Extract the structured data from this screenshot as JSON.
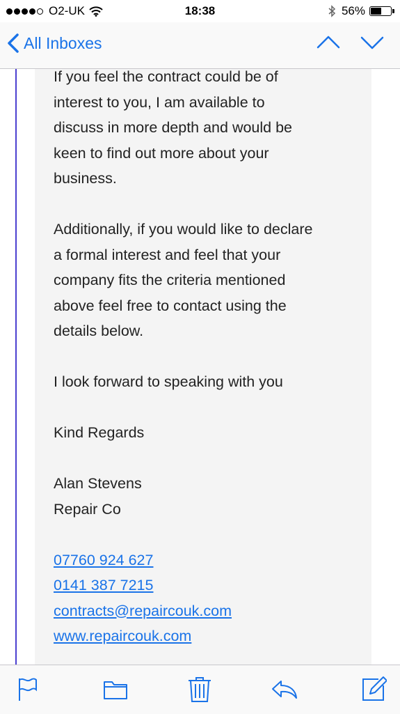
{
  "status_bar": {
    "carrier": "O2-UK",
    "time": "18:38",
    "battery_percent": "56%",
    "battery_level": 0.56,
    "signal_bars": 4,
    "signal_max": 5
  },
  "nav": {
    "back_label": "All Inboxes",
    "up_icon": "chevron-up-icon",
    "down_icon": "chevron-down-icon",
    "accent_color": "#1a73e8"
  },
  "message": {
    "paragraph1": [
      "If you feel the contract could be of",
      "interest to you, I am available to",
      "discuss in more depth and would be",
      "keen to find out more about your",
      "business."
    ],
    "paragraph2": [
      "Additionally, if you would like to declare",
      "a formal interest and feel that your",
      "company fits the criteria mentioned",
      "above feel free to contact using the",
      "details below."
    ],
    "closing_line": "I look forward to speaking with you",
    "sign_off": "Kind Regards",
    "sender_name": "Alan Stevens",
    "sender_company": "Repair Co",
    "phone_mobile": "07760 924 627",
    "phone_landline": "0141 387 7215",
    "email": "contracts@repaircouk.com",
    "website": "www.repaircouk.com"
  },
  "toolbar": {
    "icons": [
      "flag-icon",
      "folder-icon",
      "trash-icon",
      "reply-icon",
      "compose-icon"
    ]
  }
}
